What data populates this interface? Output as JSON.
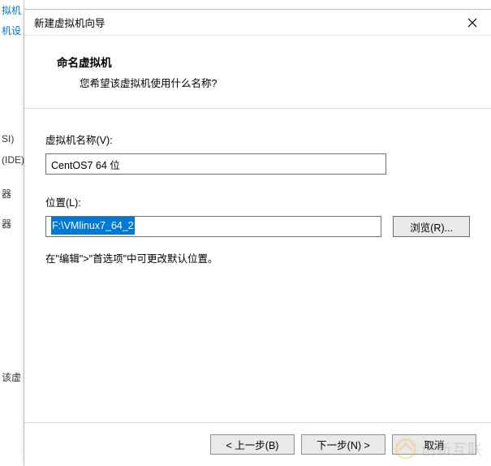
{
  "background": {
    "partial_items": [
      "拟机",
      "机设",
      "SI)",
      "(IDE)",
      "器",
      "器",
      "该虚"
    ]
  },
  "dialog": {
    "title": "新建虚拟机向导",
    "close_name": "close",
    "header": {
      "title": "命名虚拟机",
      "subtitle": "您希望该虚拟机使用什么名称?"
    },
    "name_field": {
      "label": "虚拟机名称(V):",
      "value": "CentOS7 64 位"
    },
    "location_field": {
      "label": "位置(L):",
      "value": "F:\\VMlinux7_64_2",
      "browse_label": "浏览(R)..."
    },
    "hint": "在\"编辑\">\"首选项\"中可更改默认位置。",
    "footer": {
      "back": "< 上一步(B)",
      "next": "下一步(N) >",
      "cancel": "取消"
    }
  },
  "watermark": {
    "text": "创新互联"
  }
}
